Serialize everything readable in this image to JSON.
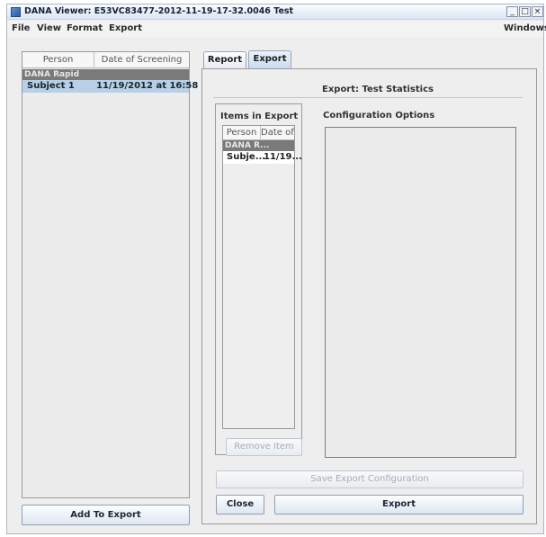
{
  "window": {
    "title": "DANA Viewer: E53VC83477-2012-11-19-17-32.0046 Test",
    "controls": {
      "minimize": "_",
      "maximize": "□",
      "close": "×"
    }
  },
  "menu": {
    "file": "File",
    "view": "View",
    "format": "Format",
    "export": "Export",
    "windows": "Windows"
  },
  "left_panel": {
    "columns": [
      "Person",
      "Date of Screening"
    ],
    "group_label": "DANA Rapid",
    "rows": [
      {
        "person": "Subject 1",
        "date": "11/19/2012 at 16:58",
        "selected": true
      }
    ],
    "add_button": "Add To Export"
  },
  "tabs": [
    {
      "label": "Report",
      "active": false
    },
    {
      "label": "Export",
      "active": true
    }
  ],
  "export_panel": {
    "header": "Export: Test Statistics",
    "items_title": "Items in Export",
    "items_columns": [
      "Person",
      "Date of..."
    ],
    "items_group": "DANA R...",
    "items_rows": [
      {
        "person": "Subje...",
        "date": "11/19..."
      }
    ],
    "remove_button": "Remove Item",
    "config_title": "Configuration Options",
    "save_config_button": "Save Export Configuration",
    "close_button": "Close",
    "export_button": "Export"
  }
}
